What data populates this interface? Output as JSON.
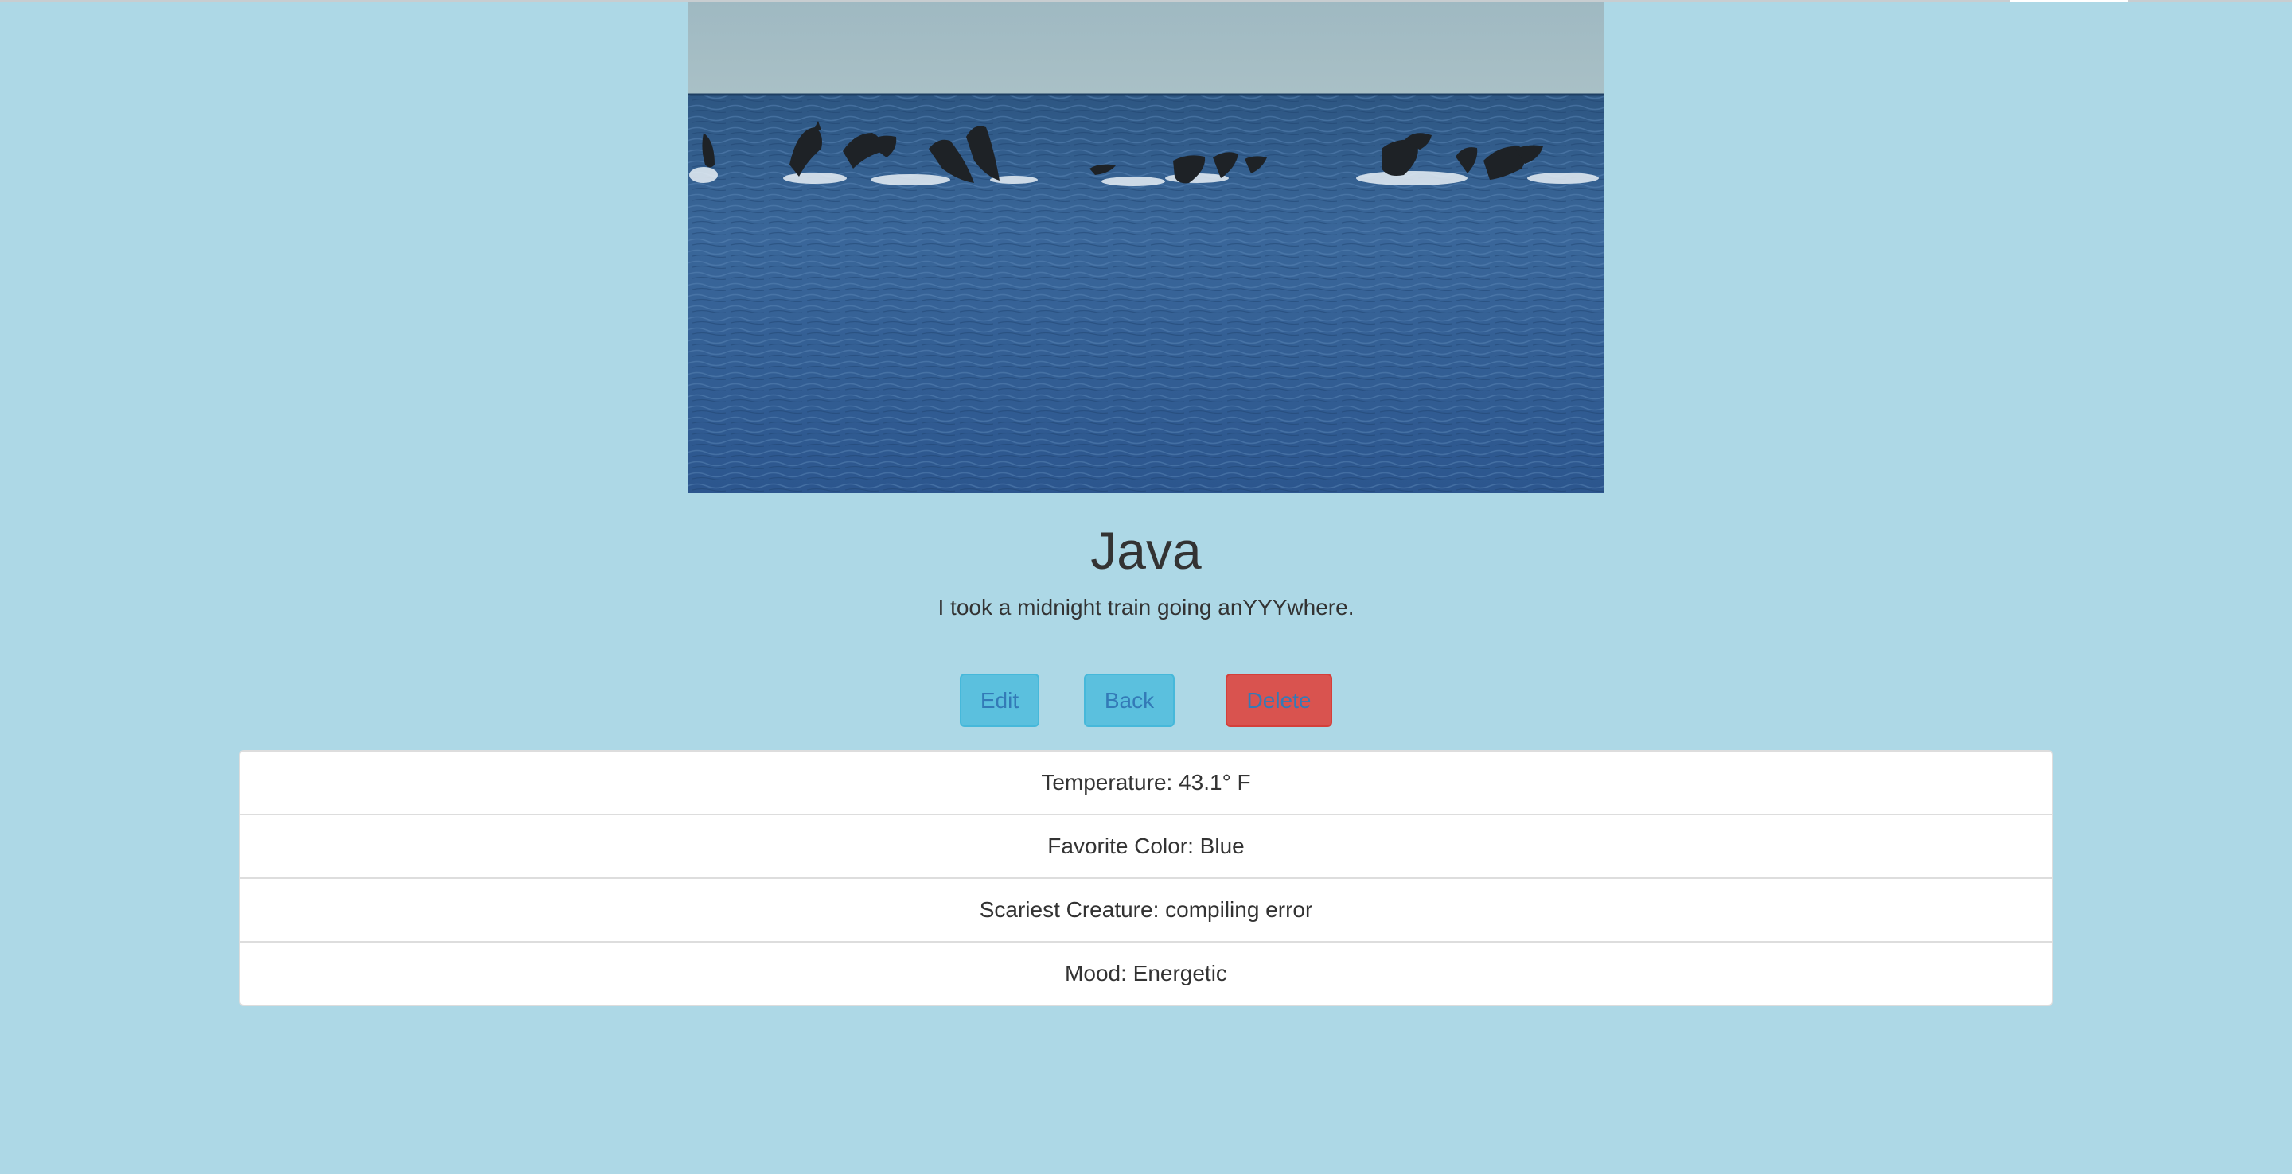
{
  "profile": {
    "name": "Java",
    "description": "I took a midnight train going anYYYwhere."
  },
  "actions": {
    "edit_label": "Edit",
    "back_label": "Back",
    "delete_label": "Delete"
  },
  "details": [
    {
      "text": "Temperature: 43.1° F"
    },
    {
      "text": "Favorite Color: Blue"
    },
    {
      "text": "Scariest Creature: compiling error"
    },
    {
      "text": "Mood: Energetic"
    }
  ],
  "colors": {
    "page_background": "#add8e6",
    "info_button": "#5bc0de",
    "danger_button": "#d9534f",
    "link_text": "#337ab7"
  },
  "image": {
    "subject": "dolphins-leaping-from-ocean"
  }
}
